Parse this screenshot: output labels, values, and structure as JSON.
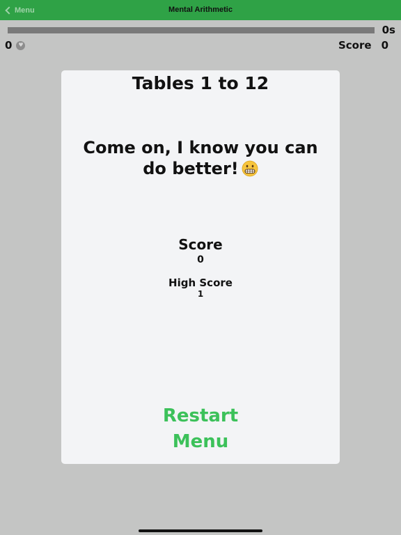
{
  "navbar": {
    "back_label": "Menu",
    "title": "Mental Arithmetic"
  },
  "timer": {
    "label": "0s",
    "remaining_fraction": 0
  },
  "stats": {
    "lives": "0",
    "score_label": "Score",
    "score": "0"
  },
  "card": {
    "title": "Tables 1 to 12",
    "message": "Come on, I know you can do better!",
    "emoji": "grimacing-face-icon",
    "score_label": "Score",
    "score_value": "0",
    "high_score_label": "High Score",
    "high_score_value": "1",
    "restart_label": "Restart",
    "menu_label": "Menu"
  },
  "colors": {
    "nav_green": "#2fa246",
    "button_green": "#3cc15a",
    "backdrop": "#c4c5c4",
    "card": "#f3f4f6",
    "timer_track": "#7a7a7a"
  }
}
